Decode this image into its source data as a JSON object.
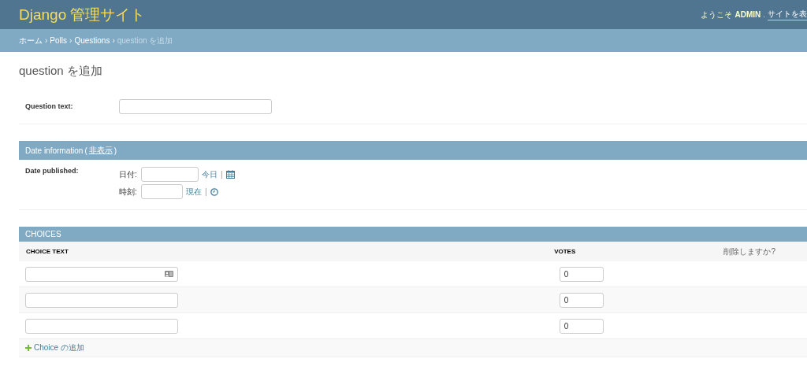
{
  "header": {
    "brand": "Django 管理サイト",
    "welcome": "ようこそ",
    "user": "ADMIN",
    "separator": ".",
    "link": "サイトを表"
  },
  "breadcrumb_separator": "›",
  "breadcrumbs": [
    {
      "label": "ホーム",
      "link": true
    },
    {
      "label": "Polls",
      "link": true
    },
    {
      "label": "Questions",
      "link": true
    },
    {
      "label": "question を追加",
      "link": false
    }
  ],
  "title": "question を追加",
  "question": {
    "label": "Question text:"
  },
  "date_section": {
    "title": "Date information",
    "open_paren": "(",
    "toggle": "非表示",
    "close_paren": ")",
    "label": "Date published:",
    "shortcut_separator": "|",
    "date": {
      "label": "日付:",
      "shortcut": "今日"
    },
    "time": {
      "label": "時刻:",
      "shortcut": "現在"
    }
  },
  "choices": {
    "title": "CHOICES",
    "columns": [
      "CHOICE TEXT",
      "VOTES",
      "削除しますか?"
    ],
    "rows": [
      {
        "votes": "0",
        "autofill_icon": true
      },
      {
        "votes": "0",
        "autofill_icon": false
      },
      {
        "votes": "0",
        "autofill_icon": false
      }
    ],
    "add": "Choice の追加"
  }
}
